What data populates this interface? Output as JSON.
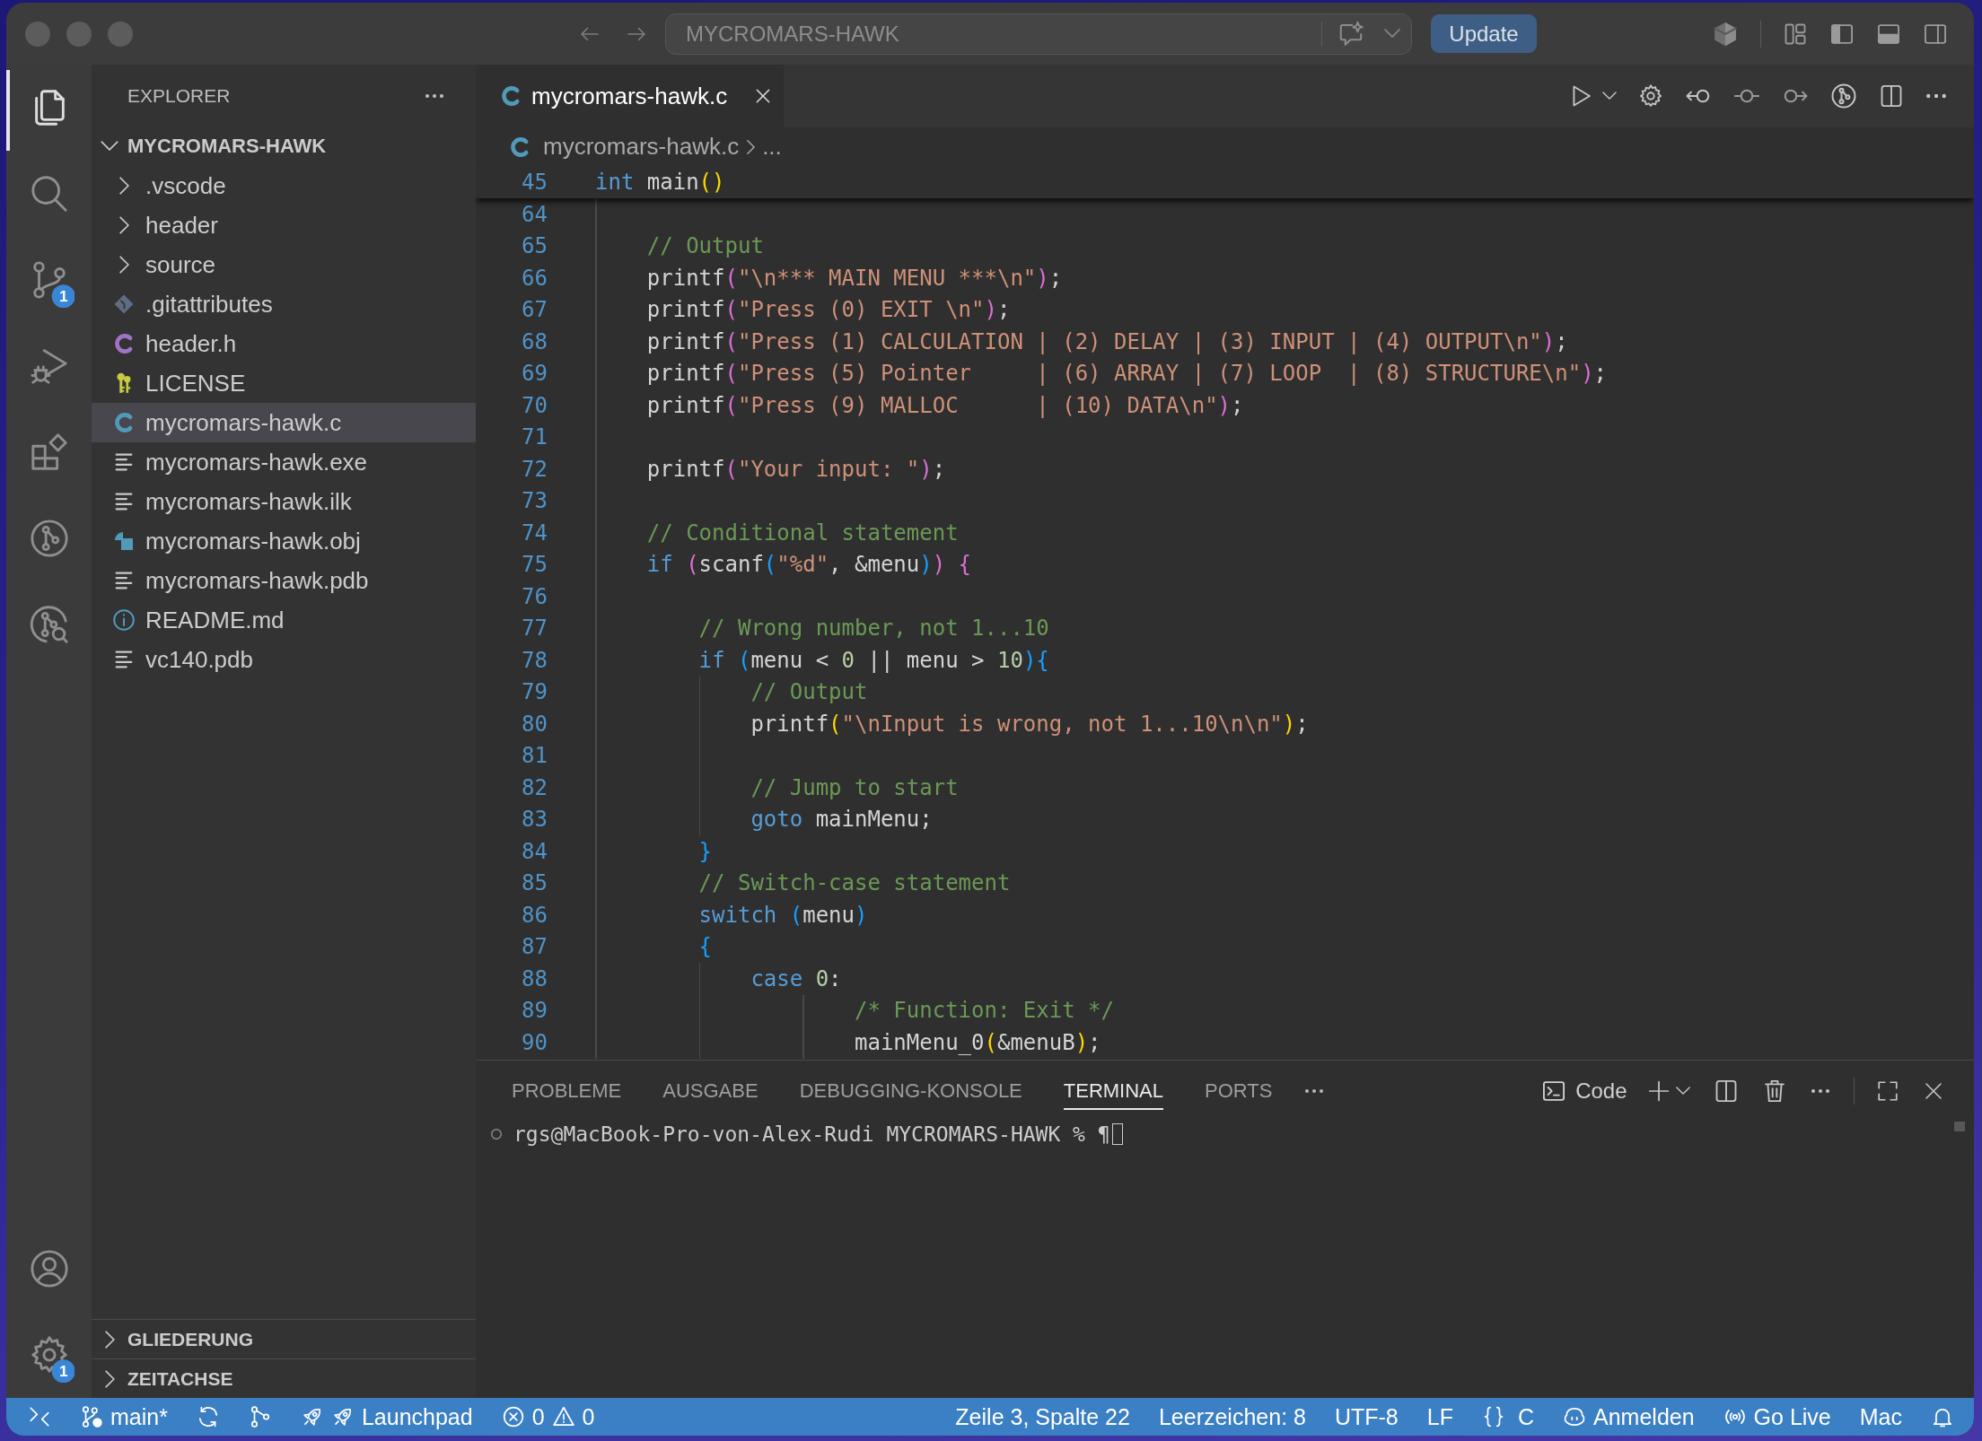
{
  "title_bar": {
    "command_center": "MYCROMARS-HAWK",
    "update_button": "Update"
  },
  "activity_bar": {
    "items": [
      {
        "kind": "explorer",
        "selected": true
      },
      {
        "kind": "search",
        "selected": false
      },
      {
        "kind": "source-control",
        "selected": false,
        "badge": "1"
      },
      {
        "kind": "run-debug",
        "selected": false
      },
      {
        "kind": "extensions",
        "selected": false
      },
      {
        "kind": "git-graph",
        "selected": false
      },
      {
        "kind": "git-inspect",
        "selected": false
      }
    ],
    "bottom_items": [
      {
        "kind": "accounts"
      },
      {
        "kind": "settings",
        "badge": "1"
      }
    ]
  },
  "sidebar": {
    "title": "EXPLORER",
    "folder": {
      "label": "MYCROMARS-HAWK",
      "expanded": true,
      "children": [
        {
          "label": ".vscode",
          "kind": "folder",
          "expanded": false,
          "selected": false
        },
        {
          "label": "header",
          "kind": "folder",
          "expanded": false,
          "selected": false
        },
        {
          "label": "source",
          "kind": "folder",
          "expanded": false,
          "selected": false
        },
        {
          "label": ".gitattributes",
          "kind": "git",
          "selected": false
        },
        {
          "label": "header.h",
          "kind": "c-header",
          "selected": false
        },
        {
          "label": "LICENSE",
          "kind": "license",
          "selected": false
        },
        {
          "label": "mycromars-hawk.c",
          "kind": "c-source",
          "selected": true
        },
        {
          "label": "mycromars-hawk.exe",
          "kind": "binary",
          "selected": false
        },
        {
          "label": "mycromars-hawk.ilk",
          "kind": "binary",
          "selected": false
        },
        {
          "label": "mycromars-hawk.obj",
          "kind": "object",
          "selected": false
        },
        {
          "label": "mycromars-hawk.pdb",
          "kind": "binary",
          "selected": false
        },
        {
          "label": "README.md",
          "kind": "readme",
          "selected": false
        },
        {
          "label": "vc140.pdb",
          "kind": "binary",
          "selected": false
        }
      ]
    },
    "sections": [
      {
        "label": "GLIEDERUNG",
        "expanded": false
      },
      {
        "label": "ZEITACHSE",
        "expanded": false
      }
    ]
  },
  "editor": {
    "tabs": [
      {
        "label": "mycromars-hawk.c",
        "selected": true
      }
    ],
    "breadcrumb": [
      "mycromars-hawk.c",
      "..."
    ],
    "sticky_lines": [
      {
        "number": "45",
        "tokens": [
          {
            "kind": "keyword",
            "text": "int"
          },
          {
            "kind": "plain",
            "text": " main"
          },
          {
            "kind": "bracket1",
            "text": "()"
          }
        ]
      }
    ],
    "lines": [
      {
        "number": "64"
      },
      {
        "number": "65",
        "tokens": [
          {
            "kind": "comment",
            "text": "    // Output"
          }
        ]
      },
      {
        "number": "66",
        "tokens": [
          {
            "kind": "plain",
            "text": "    printf"
          },
          {
            "kind": "bracket2",
            "text": "("
          },
          {
            "kind": "string",
            "text": "\"\\n*** MAIN MENU ***\\n\""
          },
          {
            "kind": "bracket2",
            "text": ")"
          },
          {
            "kind": "plain",
            "text": ";"
          }
        ]
      },
      {
        "number": "67",
        "tokens": [
          {
            "kind": "plain",
            "text": "    printf"
          },
          {
            "kind": "bracket2",
            "text": "("
          },
          {
            "kind": "string",
            "text": "\"Press (0) EXIT \\n\""
          },
          {
            "kind": "bracket2",
            "text": ")"
          },
          {
            "kind": "plain",
            "text": ";"
          }
        ]
      },
      {
        "number": "68",
        "tokens": [
          {
            "kind": "plain",
            "text": "    printf"
          },
          {
            "kind": "bracket2",
            "text": "("
          },
          {
            "kind": "string",
            "text": "\"Press (1) CALCULATION | (2) DELAY | (3) INPUT | (4) OUTPUT\\n\""
          },
          {
            "kind": "bracket2",
            "text": ")"
          },
          {
            "kind": "plain",
            "text": ";"
          }
        ]
      },
      {
        "number": "69",
        "tokens": [
          {
            "kind": "plain",
            "text": "    printf"
          },
          {
            "kind": "bracket2",
            "text": "("
          },
          {
            "kind": "string",
            "text": "\"Press (5) Pointer     | (6) ARRAY | (7) LOOP  | (8) STRUCTURE\\n\""
          },
          {
            "kind": "bracket2",
            "text": ")"
          },
          {
            "kind": "plain",
            "text": ";"
          }
        ]
      },
      {
        "number": "70",
        "tokens": [
          {
            "kind": "plain",
            "text": "    printf"
          },
          {
            "kind": "bracket2",
            "text": "("
          },
          {
            "kind": "string",
            "text": "\"Press (9) MALLOC      | (10) DATA\\n\""
          },
          {
            "kind": "bracket2",
            "text": ")"
          },
          {
            "kind": "plain",
            "text": ";"
          }
        ]
      },
      {
        "number": "71"
      },
      {
        "number": "72",
        "tokens": [
          {
            "kind": "plain",
            "text": "    printf"
          },
          {
            "kind": "bracket2",
            "text": "("
          },
          {
            "kind": "string",
            "text": "\"Your input: \""
          },
          {
            "kind": "bracket2",
            "text": ")"
          },
          {
            "kind": "plain",
            "text": ";"
          }
        ]
      },
      {
        "number": "73"
      },
      {
        "number": "74",
        "tokens": [
          {
            "kind": "comment",
            "text": "    // Conditional statement"
          }
        ]
      },
      {
        "number": "75",
        "tokens": [
          {
            "kind": "keyword",
            "text": "    if"
          },
          {
            "kind": "bracket2",
            "text": " ("
          },
          {
            "kind": "plain",
            "text": "scanf"
          },
          {
            "kind": "bracket3",
            "text": "("
          },
          {
            "kind": "string",
            "text": "\"%d\""
          },
          {
            "kind": "plain",
            "text": ", &menu"
          },
          {
            "kind": "bracket3",
            "text": ")"
          },
          {
            "kind": "bracket2",
            "text": ")"
          },
          {
            "kind": "bracket2",
            "text": " {"
          }
        ]
      },
      {
        "number": "76"
      },
      {
        "number": "77",
        "tokens": [
          {
            "kind": "comment",
            "text": "        // Wrong number, not 1...10"
          }
        ]
      },
      {
        "number": "78",
        "tokens": [
          {
            "kind": "keyword",
            "text": "        if"
          },
          {
            "kind": "bracket3",
            "text": " ("
          },
          {
            "kind": "plain",
            "text": "menu < "
          },
          {
            "kind": "number",
            "text": "0"
          },
          {
            "kind": "plain",
            "text": " || menu > "
          },
          {
            "kind": "number",
            "text": "10"
          },
          {
            "kind": "bracket3",
            "text": ")"
          },
          {
            "kind": "bracket3",
            "text": "{"
          }
        ]
      },
      {
        "number": "79",
        "tokens": [
          {
            "kind": "comment",
            "text": "            // Output"
          }
        ]
      },
      {
        "number": "80",
        "tokens": [
          {
            "kind": "plain",
            "text": "            printf"
          },
          {
            "kind": "bracket1",
            "text": "("
          },
          {
            "kind": "string",
            "text": "\"\\nInput is wrong, not 1...10\\n\\n\""
          },
          {
            "kind": "bracket1",
            "text": ")"
          },
          {
            "kind": "plain",
            "text": ";"
          }
        ]
      },
      {
        "number": "81"
      },
      {
        "number": "82",
        "tokens": [
          {
            "kind": "comment",
            "text": "            // Jump to start"
          }
        ]
      },
      {
        "number": "83",
        "tokens": [
          {
            "kind": "keyword",
            "text": "            goto"
          },
          {
            "kind": "plain",
            "text": " mainMenu;"
          }
        ]
      },
      {
        "number": "84",
        "tokens": [
          {
            "kind": "bracket3",
            "text": "        }"
          }
        ]
      },
      {
        "number": "85",
        "tokens": [
          {
            "kind": "comment",
            "text": "        // Switch-case statement"
          }
        ]
      },
      {
        "number": "86",
        "tokens": [
          {
            "kind": "keyword",
            "text": "        switch"
          },
          {
            "kind": "bracket3",
            "text": " ("
          },
          {
            "kind": "plain",
            "text": "menu"
          },
          {
            "kind": "bracket3",
            "text": ")"
          }
        ]
      },
      {
        "number": "87",
        "tokens": [
          {
            "kind": "bracket3",
            "text": "        {"
          }
        ]
      },
      {
        "number": "88",
        "tokens": [
          {
            "kind": "keyword",
            "text": "            case"
          },
          {
            "kind": "number",
            "text": " 0"
          },
          {
            "kind": "plain",
            "text": ":"
          }
        ]
      },
      {
        "number": "89",
        "tokens": [
          {
            "kind": "comment",
            "text": "                    /* Function: Exit */"
          }
        ]
      },
      {
        "number": "90",
        "tokens": [
          {
            "kind": "plain",
            "text": "                    mainMenu_0"
          },
          {
            "kind": "bracket1",
            "text": "("
          },
          {
            "kind": "plain",
            "text": "&menuB"
          },
          {
            "kind": "bracket1",
            "text": ")"
          },
          {
            "kind": "plain",
            "text": ";"
          }
        ]
      }
    ]
  },
  "panel": {
    "tabs": [
      {
        "label": "PROBLEME",
        "selected": false
      },
      {
        "label": "AUSGABE",
        "selected": false
      },
      {
        "label": "DEBUGGING-KONSOLE",
        "selected": false
      },
      {
        "label": "TERMINAL",
        "selected": true
      },
      {
        "label": "PORTS",
        "selected": false
      }
    ],
    "terminal_profile": "Code",
    "terminal_lines": [
      "rgs@MacBook-Pro-von-Alex-Rudi MYCROMARS-HAWK % ¶"
    ]
  },
  "status_bar": {
    "left": [
      {
        "kind": "remote"
      },
      {
        "kind": "branch",
        "text": "main*"
      },
      {
        "kind": "sync"
      },
      {
        "kind": "compare"
      },
      {
        "kind": "launchpad",
        "text": "Launchpad"
      },
      {
        "kind": "problems",
        "errors": "0",
        "warnings": "0"
      }
    ],
    "right": [
      {
        "kind": "text",
        "text": "Zeile 3, Spalte 22"
      },
      {
        "kind": "text",
        "text": "Leerzeichen: 8"
      },
      {
        "kind": "text",
        "text": "UTF-8"
      },
      {
        "kind": "text",
        "text": "LF"
      },
      {
        "kind": "language",
        "text": "C"
      },
      {
        "kind": "account",
        "text": "Anmelden"
      },
      {
        "kind": "live",
        "text": "Go Live"
      },
      {
        "kind": "text",
        "text": "Mac"
      },
      {
        "kind": "bell"
      }
    ]
  }
}
